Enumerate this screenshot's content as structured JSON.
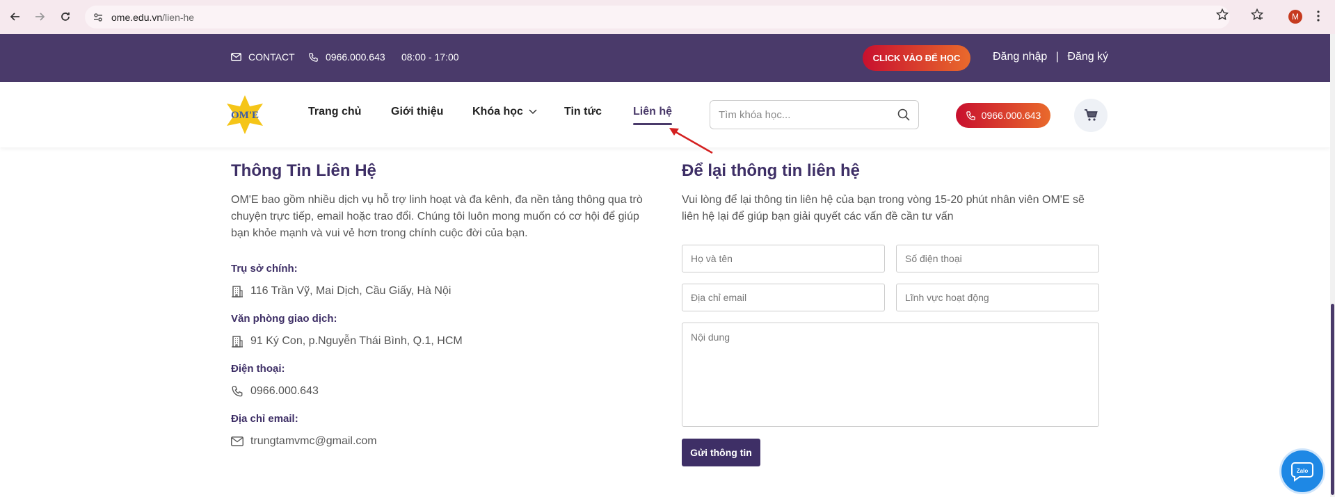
{
  "browser": {
    "url_domain": "ome.edu.vn",
    "url_path": "/lien-he",
    "profile_initial": "M"
  },
  "topbar": {
    "contact_label": "CONTACT",
    "phone": "0966.000.643",
    "hours": "08:00 - 17:00",
    "cta_label": "CLICK VÀO ĐỂ HỌC",
    "login_label": "Đăng nhập",
    "separator": "|",
    "register_label": "Đăng ký"
  },
  "header": {
    "logo_text": "OM'E",
    "menu": [
      {
        "label": "Trang chủ"
      },
      {
        "label": "Giới thiệu"
      },
      {
        "label": "Khóa học"
      },
      {
        "label": "Tin tức"
      },
      {
        "label": "Liên hệ"
      }
    ],
    "search_placeholder": "Tìm khóa học...",
    "phone_button": "0966.000.643"
  },
  "contact_info": {
    "title": "Thông Tin Liên Hệ",
    "intro": "OM'E bao gồm nhiều dịch vụ hỗ trợ linh hoạt và đa kênh, đa nền tảng thông qua trò chuyện trực tiếp, email hoặc trao đổi. Chúng tôi luôn mong muốn có cơ hội để giúp bạn khỏe mạnh và vui vẻ hơn trong chính cuộc đời của bạn.",
    "items": [
      {
        "label": "Trụ sở chính:",
        "value": "116 Trần Vỹ, Mai Dịch, Cầu Giấy, Hà Nội"
      },
      {
        "label": "Văn phòng giao dịch:",
        "value": "91 Ký Con, p.Nguyễn Thái Bình, Q.1, HCM"
      },
      {
        "label": "Điện thoại:",
        "value": "0966.000.643"
      },
      {
        "label": "Địa chỉ email:",
        "value": "trungtamvmc@gmail.com"
      }
    ]
  },
  "form": {
    "title": "Để lại thông tin liên hệ",
    "description": "Vui lòng để lại thông tin liên hệ của bạn trong vòng 15-20 phút nhân viên OM'E sẽ liên hệ lại để giúp bạn giải quyết các vấn đề cần tư vấn",
    "name_placeholder": "Họ và tên",
    "phone_placeholder": "Số điện thoại",
    "email_placeholder": "Địa chỉ email",
    "field_placeholder": "Lĩnh vực hoạt động",
    "content_placeholder": "Nội dung",
    "submit_label": "Gửi thông tin"
  },
  "zalo_label": "Zalo",
  "colors": {
    "brand_purple": "#4a3a6a",
    "heading_purple": "#3e2f66",
    "cta_red": "#c8102e",
    "cta_orange": "#e96a2c",
    "zalo_blue": "#1e88e5"
  }
}
